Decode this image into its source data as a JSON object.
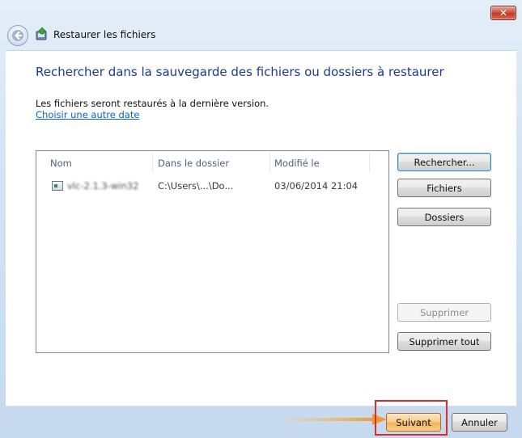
{
  "window": {
    "title": "Restaurer les fichiers",
    "close_label": "✕"
  },
  "main": {
    "heading": "Rechercher dans la sauvegarde des fichiers ou dossiers à restaurer",
    "info": "Les fichiers seront restaurés à la dernière version.",
    "choose_date_link": "Choisir une autre date"
  },
  "list": {
    "columns": [
      "Nom",
      "Dans le dossier",
      "Modifié le"
    ],
    "rows": [
      {
        "name": "vlc-2.1.3-win32",
        "folder": "C:\\Users\\...\\Do...",
        "modified": "03/06/2014 21:04"
      }
    ]
  },
  "side_buttons": {
    "search": "Rechercher...",
    "files": "Fichiers",
    "folders": "Dossiers",
    "delete": "Supprimer",
    "delete_all": "Supprimer tout"
  },
  "footer": {
    "next": "Suivant",
    "cancel": "Annuler"
  },
  "colors": {
    "heading": "#1a3c8c",
    "link": "#0b63c6",
    "highlight_box": "#d72d2d",
    "arrow": "#f0a040"
  }
}
